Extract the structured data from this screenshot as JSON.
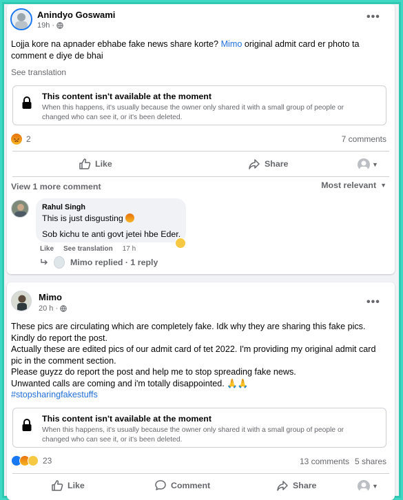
{
  "post1": {
    "author": "Anindyo Goswami",
    "time": "19h",
    "privacy_icon": "globe-icon",
    "text_before_mention": "Lojja kore na apnader ebhabe fake news share korte? ",
    "mention": "Mimo",
    "text_after_mention": " original admit card er photo ta comment e diye de bhai",
    "see_translation": "See translation",
    "notice_title": "This content isn't available at the moment",
    "notice_body": "When this happens, it's usually because the owner only shared it with a small group of people or changed who can see it, or it's been deleted.",
    "reaction_count": "2",
    "comments_count": "7 comments",
    "like_label": "Like",
    "share_label": "Share",
    "view_more_comments": "View 1 more comment",
    "sort_label": "Most relevant",
    "comment": {
      "author": "Rahul Singh",
      "line1": "This is just disgusting",
      "line2": "Sob kichu te anti govt jetei hbe Eder.",
      "like": "Like",
      "see_translation": "See translation",
      "time": "17 h"
    },
    "reply_summary": "Mimo replied · 1 reply"
  },
  "post2": {
    "author": "Mimo",
    "time": "20 h",
    "privacy_icon": "globe-icon",
    "lines": [
      "These pics are circulating which are completely fake. Idk why they are sharing this fake pics. Kindly do report the post.",
      "Actually these are edited pics of our admit card of tet 2022. I'm providing my original admit card pic in the comment section.",
      "Please guyzz do report the post and help me to stop spreading fake news.",
      "Unwanted calls are coming and i'm totally disappointed. 🙏🙏"
    ],
    "hashtag": "#stopsharingfakestuffs",
    "notice_title": "This content isn't available at the moment",
    "notice_body": "When this happens, it's usually because the owner only shared it with a small group of people or changed who can see it, or it's been deleted.",
    "reaction_count": "23",
    "comments_count": "13 comments",
    "shares_count": "5 shares",
    "like_label": "Like",
    "comment_label": "Comment",
    "share_label": "Share"
  },
  "colors": {
    "frame_border": "#3ed8c4",
    "link_blue": "#216fdb",
    "muted_text": "#65676b",
    "feed_bg": "#f0f2f5"
  }
}
